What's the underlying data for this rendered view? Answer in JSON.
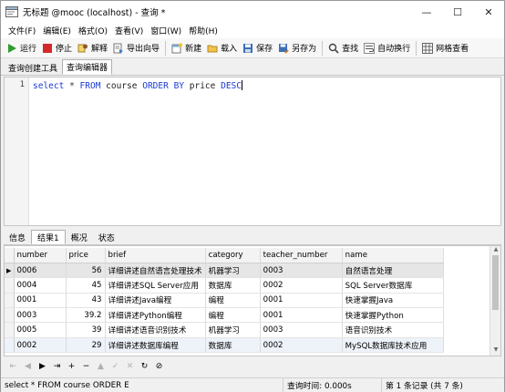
{
  "window": {
    "title": "无标题 @mooc (localhost) - 查询 *",
    "minimize_glyph": "—",
    "maximize_glyph": "☐",
    "close_glyph": "✕"
  },
  "menu": {
    "items": [
      "文件(F)",
      "编辑(E)",
      "格式(O)",
      "查看(V)",
      "窗口(W)",
      "帮助(H)"
    ]
  },
  "toolbar": {
    "run_label": "运行",
    "stop_label": "停止",
    "explain_label": "解释",
    "export_wizard_label": "导出向导",
    "new_label": "新建",
    "load_label": "载入",
    "save_label": "保存",
    "save_as_label": "另存为",
    "find_label": "查找",
    "wrap_label": "自动换行",
    "grid_view_label": "网格查看"
  },
  "tabs": {
    "query_builder": "查询创建工具",
    "query_editor": "查询编辑器"
  },
  "editor": {
    "line_number": "1",
    "sql": "select * FROM course ORDER BY price DESC"
  },
  "result_tabs": {
    "info": "信息",
    "result1": "结果1",
    "profile": "概况",
    "status": "状态"
  },
  "grid": {
    "columns": [
      "number",
      "price",
      "brief",
      "category",
      "teacher_number",
      "name"
    ],
    "rows": [
      [
        "0006",
        "56",
        "详细讲述自然语言处理技术",
        "机器学习",
        "0003",
        "自然语言处理"
      ],
      [
        "0004",
        "45",
        "详细讲述SQL Server应用",
        "数据库",
        "0002",
        "SQL Server数据库"
      ],
      [
        "0001",
        "43",
        "详细讲述Java编程",
        "编程",
        "0001",
        "快速掌握Java"
      ],
      [
        "0003",
        "39.2",
        "详细讲述Python编程",
        "编程",
        "0001",
        "快速掌握Python"
      ],
      [
        "0005",
        "39",
        "详细讲述语音识别技术",
        "机器学习",
        "0003",
        "语音识别技术"
      ],
      [
        "0002",
        "29",
        "详细讲述数据库编程",
        "数据库",
        "0002",
        "MySQL数据库技术应用"
      ]
    ],
    "current_row_marker": "▶"
  },
  "navbar": {
    "buttons": [
      "⇤",
      "◀",
      "▶",
      "⇥",
      "+",
      "−",
      "▲",
      "✓",
      "✕",
      "↻",
      "⊘"
    ]
  },
  "status": {
    "sql_preview": "select * FROM course ORDER E",
    "query_time": "查询时间: 0.000s",
    "record_info": "第 1 条记录 (共 7 条)"
  },
  "colors": {
    "keyword": "#1a3ad1",
    "run_green": "#2e9d2e",
    "stop_red": "#d22a2a"
  }
}
